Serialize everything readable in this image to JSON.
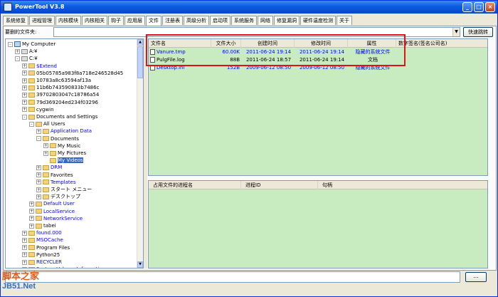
{
  "window": {
    "title": "PowerTool V3.8"
  },
  "tabs": [
    "系统修复",
    "进程管理",
    "内核模块",
    "内核相关",
    "钩子",
    "应用层",
    "文件",
    "注册表",
    "高级分析",
    "启动项",
    "系统服务",
    "网络",
    "修复漏洞",
    "硬件温度检测",
    "关于"
  ],
  "active_tab": "文件",
  "path_bar": {
    "label": "要删的文件夹:",
    "value": "",
    "jump_button": "快速跳转"
  },
  "tree": [
    {
      "label": "My Computer",
      "icon": "computer",
      "indent": 0,
      "exp": "-"
    },
    {
      "label": "A:¥",
      "icon": "drive",
      "indent": 1,
      "exp": "+"
    },
    {
      "label": "C:¥",
      "icon": "drive",
      "indent": 1,
      "exp": "-"
    },
    {
      "label": "$Extend",
      "icon": "folder",
      "indent": 2,
      "exp": "+",
      "blue": true
    },
    {
      "label": "05b05785a983f8a718e246528d45",
      "icon": "folder",
      "indent": 2,
      "exp": "+"
    },
    {
      "label": "10783a8c63594af13a",
      "icon": "folder",
      "indent": 2,
      "exp": "+"
    },
    {
      "label": "11b6b743590833b7486c",
      "icon": "folder",
      "indent": 2,
      "exp": "+"
    },
    {
      "label": "39702803047c18786a54",
      "icon": "folder",
      "indent": 2,
      "exp": "+"
    },
    {
      "label": "79d369204ed234f03296",
      "icon": "folder",
      "indent": 2,
      "exp": "+"
    },
    {
      "label": "cygwin",
      "icon": "folder",
      "indent": 2,
      "exp": "+"
    },
    {
      "label": "Documents and Settings",
      "icon": "folder",
      "indent": 2,
      "exp": "-"
    },
    {
      "label": "All Users",
      "icon": "folder",
      "indent": 3,
      "exp": "-"
    },
    {
      "label": "Application Data",
      "icon": "folder",
      "indent": 4,
      "exp": "+",
      "blue": true
    },
    {
      "label": "Documents",
      "icon": "folder",
      "indent": 4,
      "exp": "-"
    },
    {
      "label": "My Music",
      "icon": "folder",
      "indent": 5,
      "exp": "+"
    },
    {
      "label": "My Pictures",
      "icon": "folder",
      "indent": 5,
      "exp": "+"
    },
    {
      "label": "My Videos",
      "icon": "folder",
      "indent": 5,
      "exp": "",
      "sel": true
    },
    {
      "label": "DRM",
      "icon": "folder",
      "indent": 4,
      "exp": "+",
      "blue": true
    },
    {
      "label": "Favorites",
      "icon": "folder",
      "indent": 4,
      "exp": "+"
    },
    {
      "label": "Templates",
      "icon": "folder",
      "indent": 4,
      "exp": "+",
      "blue": true
    },
    {
      "label": "スタート メニュー",
      "icon": "folder",
      "indent": 4,
      "exp": "+"
    },
    {
      "label": "デスクトップ",
      "icon": "folder",
      "indent": 4,
      "exp": "+"
    },
    {
      "label": "Default User",
      "icon": "folder",
      "indent": 3,
      "exp": "+",
      "blue": true
    },
    {
      "label": "LocalService",
      "icon": "folder",
      "indent": 3,
      "exp": "+",
      "blue": true
    },
    {
      "label": "NetworkService",
      "icon": "folder",
      "indent": 3,
      "exp": "+",
      "blue": true
    },
    {
      "label": "tabei",
      "icon": "folder",
      "indent": 3,
      "exp": "+"
    },
    {
      "label": "found.000",
      "icon": "folder",
      "indent": 2,
      "exp": "+",
      "blue": true
    },
    {
      "label": "MSOCache",
      "icon": "folder",
      "indent": 2,
      "exp": "+",
      "blue": true
    },
    {
      "label": "Program Files",
      "icon": "folder",
      "indent": 2,
      "exp": "+"
    },
    {
      "label": "Python25",
      "icon": "folder",
      "indent": 2,
      "exp": "+"
    },
    {
      "label": "RECYCLER",
      "icon": "folder",
      "indent": 2,
      "exp": "+",
      "blue": true
    },
    {
      "label": "System Volume Information",
      "icon": "folder",
      "indent": 2,
      "exp": "+",
      "blue": true
    }
  ],
  "files_table": {
    "columns": [
      "文件名",
      "文件大小",
      "创建时间",
      "修改时间",
      "属性",
      "数字签名(签名公司名)"
    ],
    "rows": [
      {
        "name": "Vanure.tmp",
        "size": "60.00K",
        "created": "2011-06-24 19:14",
        "modified": "2011-06-24 19:14",
        "attr": "隐藏的系统文件",
        "blue": true
      },
      {
        "name": "PulgFile.log",
        "size": "88B",
        "created": "2011-06-24 18:57",
        "modified": "2011-06-24 19:14",
        "attr": "文档",
        "blue": false
      },
      {
        "name": "Desktop.ini",
        "size": "152B",
        "created": "2009-06-12 08:50",
        "modified": "2009-06-12 08:50",
        "attr": "隐藏的系统文件",
        "blue": true
      }
    ]
  },
  "process_table": {
    "columns": [
      "占用文件的进程名",
      "进程ID",
      "句柄"
    ]
  },
  "statusbar": {
    "button": "..."
  },
  "watermark": {
    "line1": "脚本之家",
    "line2": "JB51.Net"
  },
  "colors": {
    "grid_bg": "#c8ecc0",
    "highlight": "#e0121c",
    "title_bar": "#0a5ae0"
  }
}
